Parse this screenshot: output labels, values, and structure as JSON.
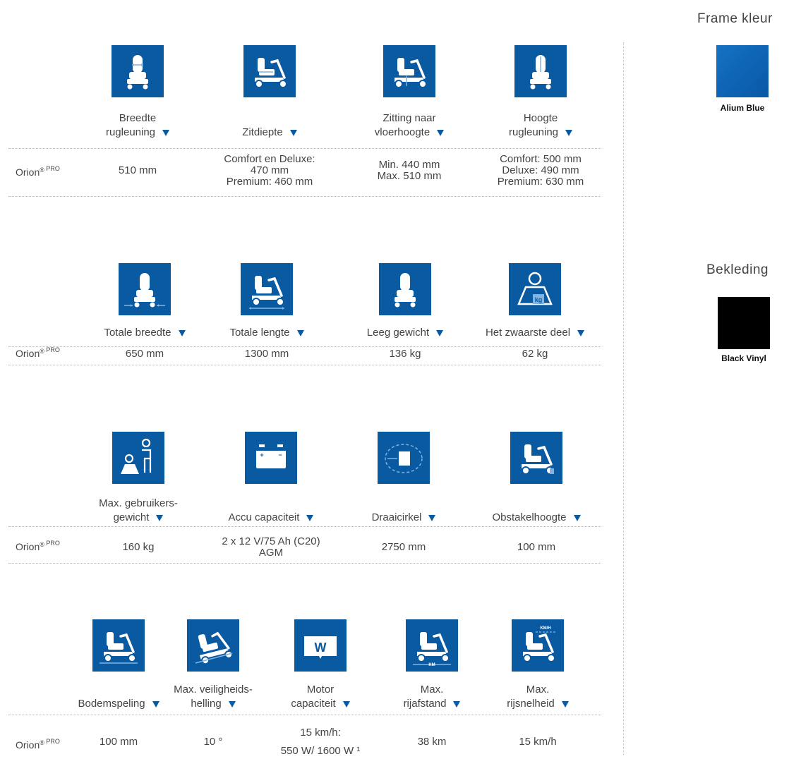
{
  "colors": {
    "accent": "#0a5aa2",
    "alium_blue": "#0d63b4",
    "black_vinyl": "#000000"
  },
  "sidebar": {
    "frame_title": "Frame kleur",
    "frame_swatch_label": "Alium Blue",
    "upholstery_title": "Bekleding",
    "upholstery_swatch_label": "Black Vinyl"
  },
  "row_label": {
    "name": "Orion",
    "mark": "®",
    "suffix": "PRO"
  },
  "sections": [
    {
      "specs": [
        {
          "icon": "backrest-width-icon",
          "label_lines": [
            "Breedte",
            "rugleuning"
          ],
          "value_lines": [
            "510 mm"
          ]
        },
        {
          "icon": "seat-depth-icon",
          "label_lines": [
            "Zitdiepte"
          ],
          "value_lines": [
            "Comfort en Deluxe:",
            "470 mm",
            "Premium: 460 mm"
          ]
        },
        {
          "icon": "seat-to-floor-height-icon",
          "label_lines": [
            "Zitting naar",
            "vloerhoogte"
          ],
          "value_lines": [
            "Min. 440 mm",
            "Max. 510 mm"
          ]
        },
        {
          "icon": "backrest-height-icon",
          "label_lines": [
            "Hoogte",
            "rugleuning"
          ],
          "value_lines": [
            "Comfort: 500 mm",
            "Deluxe: 490 mm",
            "Premium: 630 mm"
          ]
        }
      ]
    },
    {
      "specs": [
        {
          "icon": "total-width-icon",
          "label_lines": [
            "Totale breedte"
          ],
          "value_lines": [
            "650 mm"
          ]
        },
        {
          "icon": "total-length-icon",
          "label_lines": [
            "Totale lengte"
          ],
          "value_lines": [
            "1300 mm"
          ]
        },
        {
          "icon": "empty-weight-icon",
          "label_lines": [
            "Leeg gewicht"
          ],
          "value_lines": [
            "136 kg"
          ]
        },
        {
          "icon": "heaviest-part-icon",
          "label_lines": [
            "Het zwaarste deel"
          ],
          "value_lines": [
            "62 kg"
          ]
        }
      ]
    },
    {
      "specs": [
        {
          "icon": "max-user-weight-icon",
          "label_lines": [
            "Max. gebruikers-",
            "gewicht"
          ],
          "value_lines": [
            "160 kg"
          ]
        },
        {
          "icon": "battery-icon",
          "label_lines": [
            "Accu capaciteit"
          ],
          "value_lines": [
            "2 x 12 V/75 Ah (C20)",
            "AGM"
          ]
        },
        {
          "icon": "turning-circle-icon",
          "label_lines": [
            "Draaicirkel"
          ],
          "value_lines": [
            "2750 mm"
          ]
        },
        {
          "icon": "obstacle-height-icon",
          "label_lines": [
            "Obstakelhoogte"
          ],
          "value_lines": [
            "100 mm"
          ]
        }
      ]
    },
    {
      "specs": [
        {
          "icon": "ground-clearance-icon",
          "label_lines": [
            "Bodemspeling"
          ],
          "value_lines": [
            "100 mm"
          ]
        },
        {
          "icon": "safety-slope-icon",
          "label_lines": [
            "Max. veiligheids-",
            "helling"
          ],
          "value_lines": [
            "10 °"
          ]
        },
        {
          "icon": "motor-capacity-icon",
          "label_lines": [
            "Motor",
            "capaciteit"
          ],
          "value_lines": [
            "15 km/h:",
            "550 W/ 1600 W ¹"
          ]
        },
        {
          "icon": "max-range-icon",
          "label_lines": [
            "Max.",
            "rijafstand"
          ],
          "value_lines": [
            "38 km"
          ]
        },
        {
          "icon": "max-speed-icon",
          "label_lines": [
            "Max.",
            "rijsnelheid"
          ],
          "value_lines": [
            "15 km/h"
          ]
        }
      ]
    }
  ],
  "icon_glyphs": {
    "heaviest_part_unit": "kg",
    "motor_unit": "W",
    "range_unit": "KM",
    "speed_unit": "KM/H"
  }
}
